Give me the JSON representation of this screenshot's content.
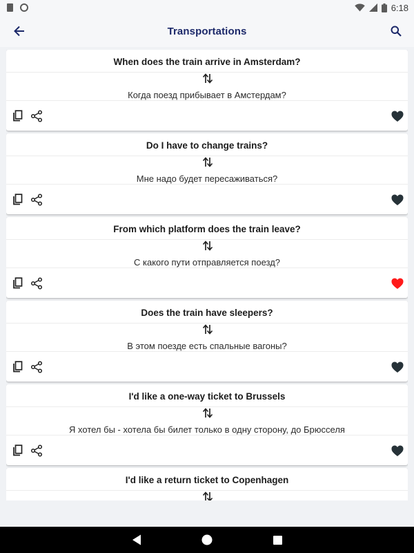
{
  "status_bar": {
    "time": "6:18"
  },
  "app_bar": {
    "title": "Transportations"
  },
  "cards": [
    {
      "english": "When does the train arrive in Amsterdam?",
      "russian": "Когда поезд прибывает в Амстердам?",
      "favorite": false
    },
    {
      "english": "Do I have to change trains?",
      "russian": "Мне надо будет пересаживаться?",
      "favorite": false
    },
    {
      "english": "From which platform does the train leave?",
      "russian": "С какого пути отправляется поезд?",
      "favorite": true
    },
    {
      "english": "Does the train have sleepers?",
      "russian": "В этом поезде есть спальные вагоны?",
      "favorite": false
    },
    {
      "english": "I'd like a one-way ticket to Brussels",
      "russian": "Я хотел бы - хотела бы билет только в одну сторону, до Брюсселя",
      "favorite": false
    },
    {
      "english": "I'd like a return ticket to Copenhagen",
      "russian": "",
      "favorite": false
    }
  ],
  "colors": {
    "accent": "#1b2869",
    "favorite_on": "#ff1a1a",
    "favorite_off": "#263238",
    "icon": "#222222"
  },
  "icons": [
    "back-arrow-icon",
    "search-icon",
    "swap-icon",
    "copy-icon",
    "share-icon",
    "heart-icon",
    "nav-back-icon",
    "nav-home-icon",
    "nav-recents-icon"
  ]
}
